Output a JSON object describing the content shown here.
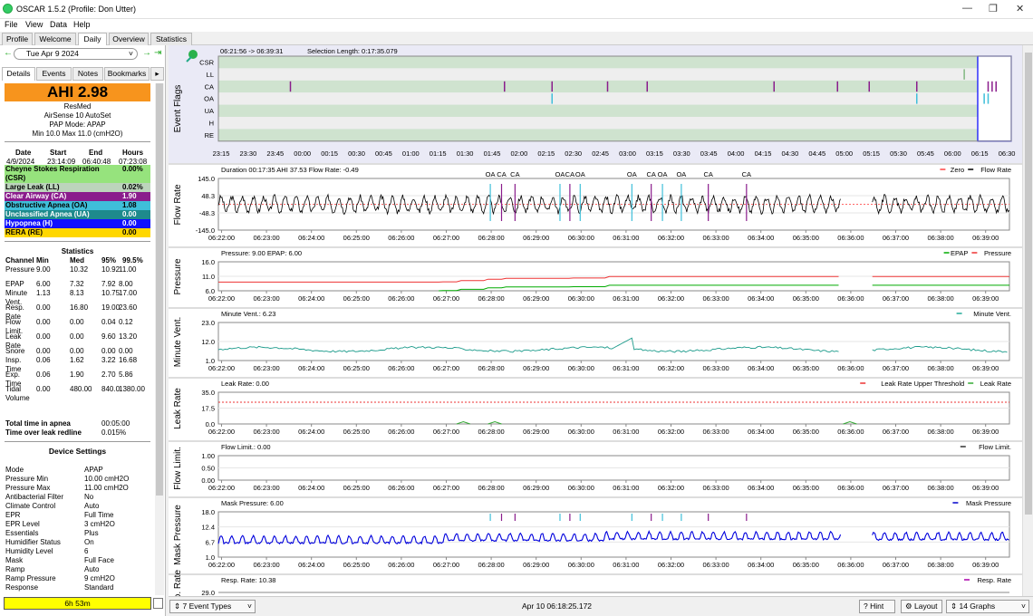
{
  "window": {
    "title": "OSCAR 1.5.2 (Profile: Don Utter)"
  },
  "menu": [
    "File",
    "View",
    "Data",
    "Help"
  ],
  "tabs": [
    "Profile",
    "Welcome",
    "Daily",
    "Overview",
    "Statistics"
  ],
  "date_label": "Tue Apr 9 2024",
  "subtabs": [
    "Details",
    "Events",
    "Notes",
    "Bookmarks"
  ],
  "ahi": "AHI 2.98",
  "machine": {
    "brand": "ResMed",
    "model": "AirSense 10 AutoSet",
    "mode": "PAP Mode: APAP",
    "pressure": "Min 10.0 Max 11.0 (cmH2O)"
  },
  "session": {
    "headers": [
      "Date",
      "Start",
      "End",
      "Hours"
    ],
    "values": [
      "4/9/2024",
      "23:14:09",
      "06:40:48",
      "07:23:08"
    ]
  },
  "indices": [
    {
      "label": "Cheyne Stokes Respiration (CSR)",
      "value": "0.00%",
      "color": "#96e37d",
      "text": "#000"
    },
    {
      "label": "Large Leak (LL)",
      "value": "0.02%",
      "color": "#bcd4bc",
      "text": "#000"
    },
    {
      "label": "Clear Airway (CA)",
      "value": "1.90",
      "color": "#8a1c8c",
      "text": "#fff"
    },
    {
      "label": "Obstructive Apnea (OA)",
      "value": "1.08",
      "color": "#3fbfd9",
      "text": "#000"
    },
    {
      "label": "Unclassified Apnea (UA)",
      "value": "0.00",
      "color": "#1e8a8c",
      "text": "#fff"
    },
    {
      "label": "Hypopnea (H)",
      "value": "0.00",
      "color": "#1010ff",
      "text": "#fff"
    },
    {
      "label": "RERA (RE)",
      "value": "0.00",
      "color": "#ffd700",
      "text": "#000"
    }
  ],
  "statistics": {
    "title": "Statistics",
    "headers": [
      "Channel",
      "Min",
      "Med",
      "95%",
      "99.5%"
    ],
    "rows": [
      [
        "Pressure",
        "9.00",
        "10.32",
        "10.92",
        "11.00"
      ],
      [
        "EPAP",
        "6.00",
        "7.32",
        "7.92",
        "8.00"
      ],
      [
        "Minute Vent.",
        "1.13",
        "8.13",
        "10.75",
        "17.00"
      ],
      [
        "Resp. Rate",
        "0.00",
        "16.80",
        "19.00",
        "23.60"
      ],
      [
        "Flow Limit.",
        "0.00",
        "0.00",
        "0.04",
        "0.12"
      ],
      [
        "Leak Rate",
        "0.00",
        "0.00",
        "9.60",
        "13.20"
      ],
      [
        "Snore",
        "0.00",
        "0.00",
        "0.00",
        "0.00"
      ],
      [
        "Insp. Time",
        "0.06",
        "1.62",
        "3.22",
        "16.68"
      ],
      [
        "Exp. Time",
        "0.06",
        "1.90",
        "2.70",
        "5.86"
      ],
      [
        "Tidal Volume",
        "0.00",
        "480.00",
        "840.0",
        "1380.00"
      ]
    ],
    "apnea_time_label": "Total time in apnea",
    "apnea_time": "00:05:00",
    "leak_redline_label": "Time over leak redline",
    "leak_redline": "0.015%"
  },
  "device": {
    "title": "Device Settings",
    "rows": [
      [
        "Mode",
        "APAP"
      ],
      [
        "Pressure Min",
        "10.00 cmH2O"
      ],
      [
        "Pressure Max",
        "11.00 cmH2O"
      ],
      [
        "Antibacterial Filter",
        "No"
      ],
      [
        "Climate Control",
        "Auto"
      ],
      [
        "EPR",
        "Full Time"
      ],
      [
        "EPR Level",
        "3 cmH2O"
      ],
      [
        "Essentials",
        "Plus"
      ],
      [
        "Humidifier Status",
        "On"
      ],
      [
        "Humidity Level",
        "6"
      ],
      [
        "Mask",
        "Full Face"
      ],
      [
        "Ramp",
        "Auto"
      ],
      [
        "Ramp Pressure",
        "9 cmH2O"
      ],
      [
        "Response",
        "Standard"
      ]
    ]
  },
  "duration_bar": "6h 53m",
  "flags": {
    "range": "06:21:56 -> 06:39:31",
    "selection": "Selection Length: 0:17:35.079",
    "ylabel": "Event Flags",
    "rows": [
      "CSR",
      "LL",
      "CA",
      "OA",
      "UA",
      "H",
      "RE"
    ],
    "ticks": [
      "23:15",
      "23:30",
      "23:45",
      "00:00",
      "00:15",
      "00:30",
      "00:45",
      "01:00",
      "01:15",
      "01:30",
      "01:45",
      "02:00",
      "02:15",
      "02:30",
      "02:45",
      "03:00",
      "03:15",
      "03:30",
      "03:45",
      "04:00",
      "04:15",
      "04:30",
      "04:45",
      "05:00",
      "05:15",
      "05:30",
      "05:45",
      "06:00",
      "06:15",
      "06:30"
    ]
  },
  "time_ticks": [
    "06:22:00",
    "06:23:00",
    "06:24:00",
    "06:25:00",
    "06:26:00",
    "06:27:00",
    "06:28:00",
    "06:29:00",
    "06:30:00",
    "06:31:00",
    "06:32:00",
    "06:33:00",
    "06:34:00",
    "06:35:00",
    "06:36:00",
    "06:37:00",
    "06:38:00",
    "06:39:00"
  ],
  "graphs": [
    {
      "ylabel": "Flow Rate",
      "info": "Duration 00:17:35 AHI 37.53 Flow Rate: -0.49",
      "legend": [
        "Zero",
        "Flow Rate"
      ],
      "yticks": [
        "145.0",
        "48.3",
        "-48.3",
        "-145.0"
      ],
      "event_labels": [
        "OA",
        "CA",
        "CA",
        "OA",
        "CA",
        "OA",
        "OA",
        "CA",
        "OA",
        "OA",
        "CA",
        "CA"
      ]
    },
    {
      "ylabel": "Pressure",
      "info": "Pressure: 9.00 EPAP: 6.00",
      "legend": [
        "EPAP",
        "Pressure"
      ],
      "yticks": [
        "16.0",
        "11.0",
        "6.0"
      ]
    },
    {
      "ylabel": "Minute Vent.",
      "info": "Minute Vent.: 6.23",
      "legend": [
        "Minute Vent."
      ],
      "yticks": [
        "23.0",
        "12.0",
        "1.0"
      ]
    },
    {
      "ylabel": "Leak Rate",
      "info": "Leak Rate: 0.00",
      "legend": [
        "Leak Rate Upper Threshold",
        "Leak Rate"
      ],
      "yticks": [
        "35.0",
        "17.5",
        "0.0"
      ]
    },
    {
      "ylabel": "Flow Limit.",
      "info": "Flow Limit.: 0.00",
      "legend": [
        "Flow Limit."
      ],
      "yticks": [
        "1.00",
        "0.50",
        "0.00"
      ]
    },
    {
      "ylabel": "Mask Pressure",
      "info": "Mask Pressure: 6.00",
      "legend": [
        "Mask Pressure"
      ],
      "yticks": [
        "18.0",
        "12.4",
        "6.7",
        "1.0"
      ]
    },
    {
      "ylabel": "Resp. Rate",
      "info": "Resp. Rate: 10.38",
      "legend": [
        "Resp. Rate"
      ],
      "yticks": [
        "29.0"
      ]
    }
  ],
  "status": {
    "event_types": "7 Event Types",
    "datetime": "Apr 10 06:18:25.172",
    "hint": "Hint",
    "layout": "Layout",
    "graphs": "14 Graphs"
  }
}
